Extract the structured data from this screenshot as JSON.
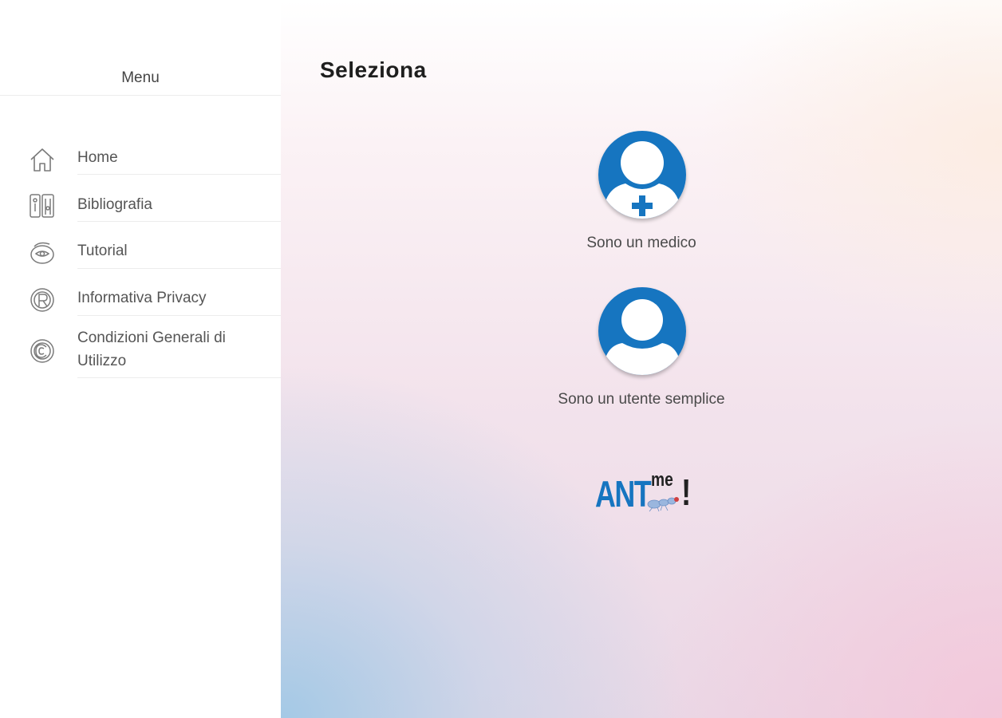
{
  "sidebar": {
    "title": "Menu",
    "items": [
      {
        "label": "Home",
        "icon": "home-icon"
      },
      {
        "label": "Bibliografia",
        "icon": "books-icon"
      },
      {
        "label": "Tutorial",
        "icon": "tutorial-icon"
      },
      {
        "label": "Informativa Privacy",
        "icon": "privacy-icon"
      },
      {
        "label": "Condizioni Generali di Utilizzo",
        "icon": "copyright-icon"
      }
    ]
  },
  "main": {
    "title": "Seleziona",
    "choices": [
      {
        "label": "Sono un medico",
        "icon": "doctor-icon"
      },
      {
        "label": "Sono un utente semplice",
        "icon": "user-icon"
      }
    ],
    "logo": {
      "ant": "ANT",
      "me": "me",
      "exclamation": "!"
    }
  },
  "colors": {
    "accent": "#1675c0",
    "text": "#555555",
    "divider": "#ececec"
  }
}
